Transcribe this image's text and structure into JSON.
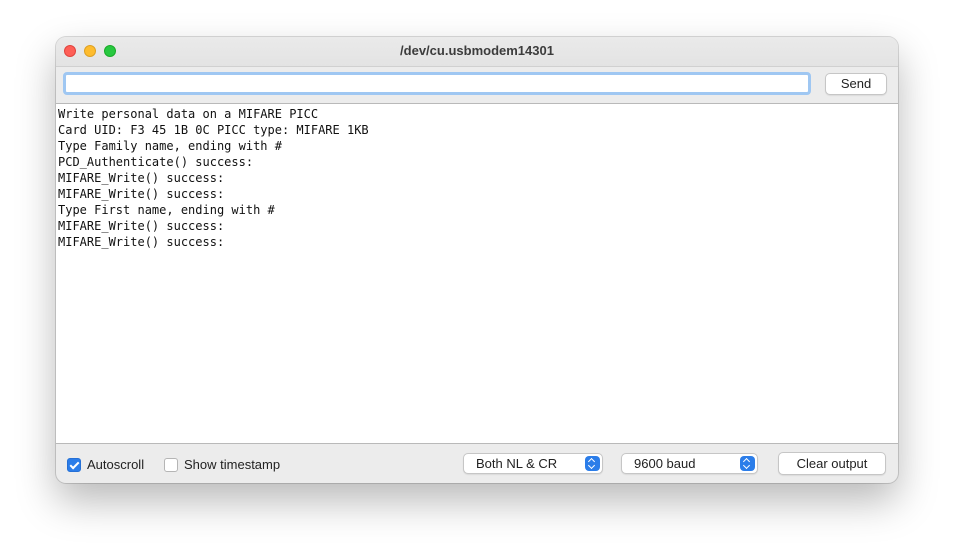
{
  "window": {
    "title": "/dev/cu.usbmodem14301"
  },
  "send_bar": {
    "input_value": "",
    "input_placeholder": "",
    "send_label": "Send"
  },
  "output": {
    "lines": [
      "Write personal data on a MIFARE PICC",
      "Card UID: F3 45 1B 0C PICC type: MIFARE 1KB",
      "Type Family name, ending with #",
      "PCD_Authenticate() success:",
      "MIFARE_Write() success:",
      "MIFARE_Write() success:",
      "Type First name, ending with #",
      "MIFARE_Write() success:",
      "MIFARE_Write() success:"
    ]
  },
  "footer": {
    "autoscroll_label": "Autoscroll",
    "autoscroll_checked": true,
    "timestamp_label": "Show timestamp",
    "timestamp_checked": false,
    "line_ending_selected": "Both NL & CR",
    "baud_selected": "9600 baud",
    "clear_label": "Clear output"
  },
  "colors": {
    "accent": "#2b7de9",
    "focus_ring": "#9fc7f2",
    "close": "#fe5f57",
    "minimize": "#febc2e",
    "maximize": "#28c840"
  },
  "icons": {
    "checkmark": "checkmark-icon",
    "select_arrows": "chevron-up-down-icon"
  }
}
